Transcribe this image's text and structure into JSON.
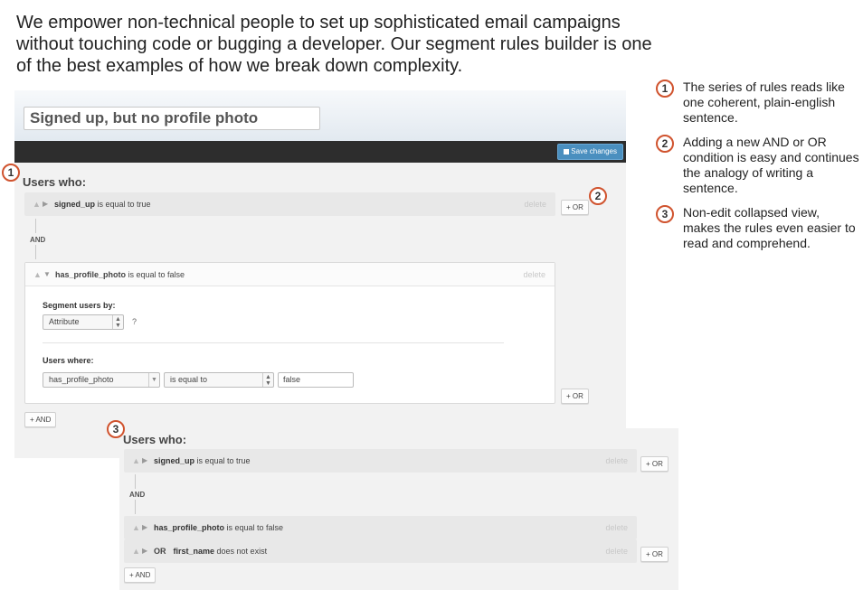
{
  "intro": "We empower non-technical people to set up sophisticated email campaigns without touching code or bugging a developer. Our segment rules builder is one of the best examples of how we break down complexity.",
  "notes": [
    {
      "num": "1",
      "text": "The series of rules reads like one coherent, plain-english sentence."
    },
    {
      "num": "2",
      "text": "Adding a new AND or OR condition is easy and continues the analogy of writing a sentence."
    },
    {
      "num": "3",
      "text": "Non-edit collapsed view, makes the rules even easier to read and comprehend."
    }
  ],
  "markers": {
    "m1": "1",
    "m2": "2",
    "m3": "3"
  },
  "editor": {
    "segment_name": "Signed up, but no profile photo",
    "save_label": "Save changes",
    "users_who": "Users who:",
    "rule1": {
      "field": "signed_up",
      "condition": " is equal to true",
      "delete": "delete"
    },
    "and_label": "AND",
    "or_button": "+ OR",
    "and_button": "+ AND",
    "rule2": {
      "field": "has_profile_photo",
      "condition": " is equal to false",
      "delete": "delete",
      "segment_by_label": "Segment users by:",
      "segment_by_value": "Attribute",
      "help": "?",
      "users_where_label": "Users where:",
      "attribute_value": "has_profile_photo",
      "operator_value": "is equal to",
      "value": "false"
    }
  },
  "collapsed": {
    "users_who": "Users who:",
    "rule1": {
      "field": "signed_up",
      "condition": " is equal to true",
      "delete": "delete"
    },
    "and_label": "AND",
    "rule2": {
      "field": "has_profile_photo",
      "condition": " is equal to false",
      "delete": "delete"
    },
    "rule3": {
      "or_tag": "OR",
      "field": "first_name",
      "condition": " does not exist",
      "delete": "delete"
    },
    "or_button": "+ OR",
    "and_button": "+ AND"
  },
  "colors": {
    "marker_ring": "#d0532e",
    "save_button": "#4a8fbf",
    "dark_bar": "#2d2d2d"
  },
  "icons": {
    "person": "person-icon",
    "expand": "caret-right-icon",
    "collapse": "caret-down-icon",
    "save": "disk-icon"
  }
}
